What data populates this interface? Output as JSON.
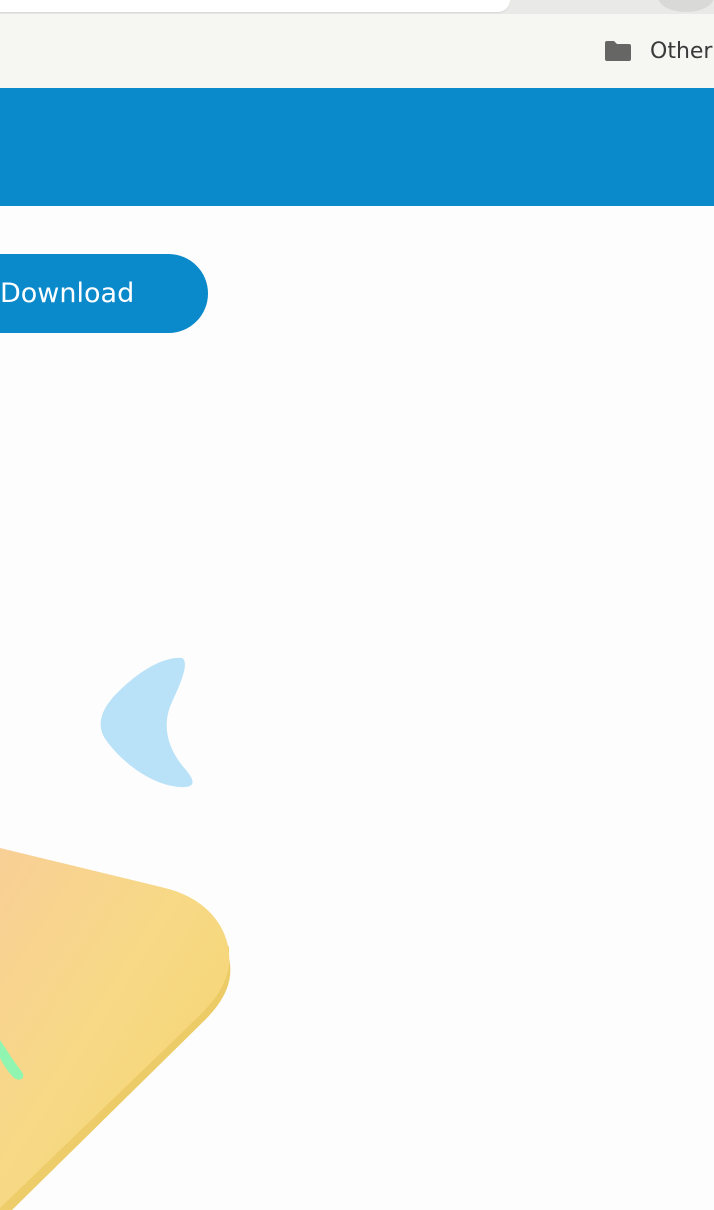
{
  "bookmarks": {
    "other_label": "Other"
  },
  "hero": {
    "download_label": "Download"
  },
  "colors": {
    "brand_blue": "#0a89cb",
    "bookmarks_bg": "#f6f6f2",
    "blob_light_blue": "#b9e2f8",
    "card_yellow": "#f6d87b",
    "card_peach": "#f8cf96",
    "accent_green": "#8ff5b0"
  }
}
